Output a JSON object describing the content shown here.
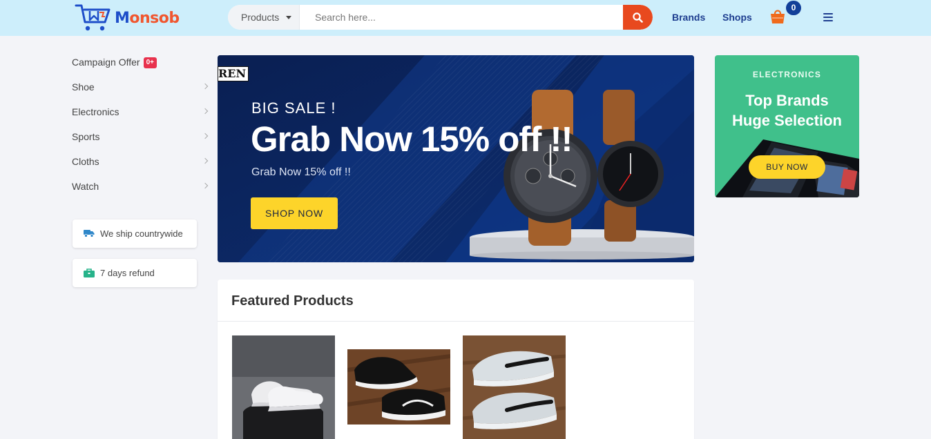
{
  "header": {
    "logo_text_first": "M",
    "logo_text_rest": "onsob",
    "search": {
      "category": "Products",
      "placeholder": "Search here..."
    },
    "nav": {
      "brands": "Brands",
      "shops": "Shops"
    },
    "cart_count": "0"
  },
  "sidebar": {
    "categories": [
      {
        "label": "Campaign Offer",
        "badge": "0+"
      },
      {
        "label": "Shoe"
      },
      {
        "label": "Electronics"
      },
      {
        "label": "Sports"
      },
      {
        "label": "Cloths"
      },
      {
        "label": "Watch"
      }
    ],
    "info": [
      {
        "label": "We ship countrywide",
        "icon": "truck-icon"
      },
      {
        "label": "7 days refund",
        "icon": "briefcase-icon"
      }
    ]
  },
  "hero": {
    "brand_fragment": "REN",
    "kicker": "BIG SALE !",
    "title": "Grab Now 15% off !!",
    "subtitle": "Grab Now 15% off !!",
    "button": "SHOP NOW"
  },
  "promo": {
    "kicker": "ELECTRONICS",
    "title_line1": "Top Brands",
    "title_line2": "Huge Selection",
    "button": "BUY NOW"
  },
  "featured": {
    "title": "Featured Products"
  },
  "colors": {
    "header_bg": "#cdeefb",
    "brand_blue": "#1d3d8f",
    "accent_orange": "#e8491e",
    "hero_bg": "#0c2660",
    "promo_green": "#40c08b",
    "button_yellow": "#fdd42a"
  }
}
